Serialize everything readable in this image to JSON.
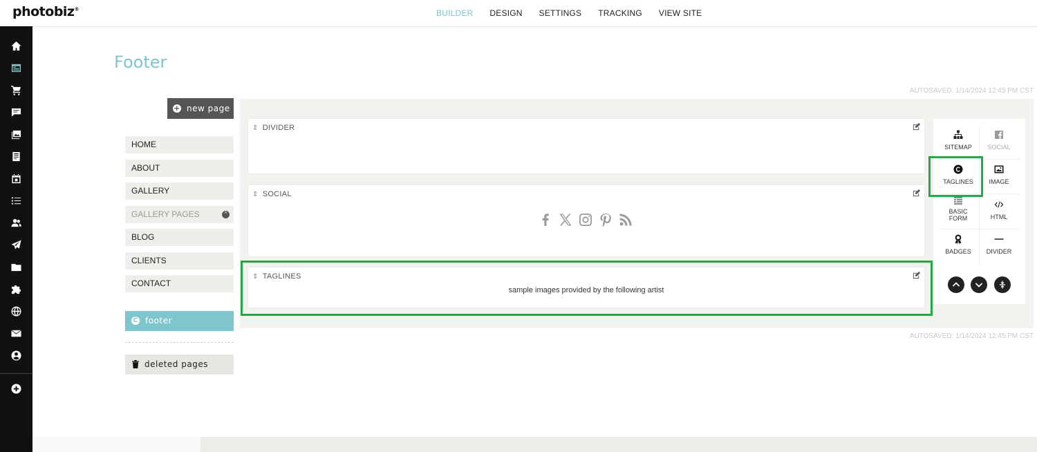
{
  "app": {
    "logo": "photobiz",
    "logo_mark": "®"
  },
  "topnav": {
    "items": [
      "BUILDER",
      "DESIGN",
      "SETTINGS",
      "TRACKING",
      "VIEW SITE"
    ],
    "active": "BUILDER"
  },
  "rail": {
    "icons": [
      "home-icon",
      "website-icon",
      "cart-icon",
      "comment-icon",
      "gallery-icon",
      "document-icon",
      "calendar-icon",
      "list-icon",
      "users-icon",
      "send-icon",
      "folder-icon",
      "puzzle-icon",
      "globe-icon",
      "mail-icon",
      "account-icon",
      "add-icon"
    ]
  },
  "page": {
    "title": "Footer",
    "autosave_top": "AUTOSAVED: 1/14/2024 12:45 PM CST",
    "autosave_bottom": "AUTOSAVED: 1/14/2024 12:45 PM CST"
  },
  "sidebar": {
    "new_page": "new page",
    "pages": [
      "HOME",
      "ABOUT",
      "GALLERY",
      "GALLERY PAGES",
      "BLOG",
      "CLIENTS",
      "CONTACT"
    ],
    "current": "footer",
    "deleted": "deleted pages"
  },
  "blocks": [
    {
      "label": "DIVIDER"
    },
    {
      "label": "SOCIAL",
      "icons": [
        "facebook-icon",
        "x-icon",
        "instagram-icon",
        "pinterest-icon",
        "rss-icon"
      ]
    },
    {
      "label": "TAGLINES",
      "text": "sample images provided by the following artist"
    }
  ],
  "widgets": {
    "items": [
      {
        "label": "SITEMAP",
        "icon": "sitemap-icon"
      },
      {
        "label": "SOCIAL",
        "icon": "facebook-icon",
        "disabled": true
      },
      {
        "label": "TAGLINES",
        "icon": "copyright-icon"
      },
      {
        "label": "IMAGE",
        "icon": "image-icon"
      },
      {
        "label": "BASIC",
        "label2": "FORM",
        "icon": "form-icon"
      },
      {
        "label": "HTML",
        "icon": "code-icon"
      },
      {
        "label": "BADGES",
        "icon": "badge-icon"
      },
      {
        "label": "DIVIDER",
        "icon": "divider-icon"
      }
    ]
  },
  "colors": {
    "accent": "#7ec5ce",
    "highlight": "#22a845",
    "rail": "#111111"
  }
}
